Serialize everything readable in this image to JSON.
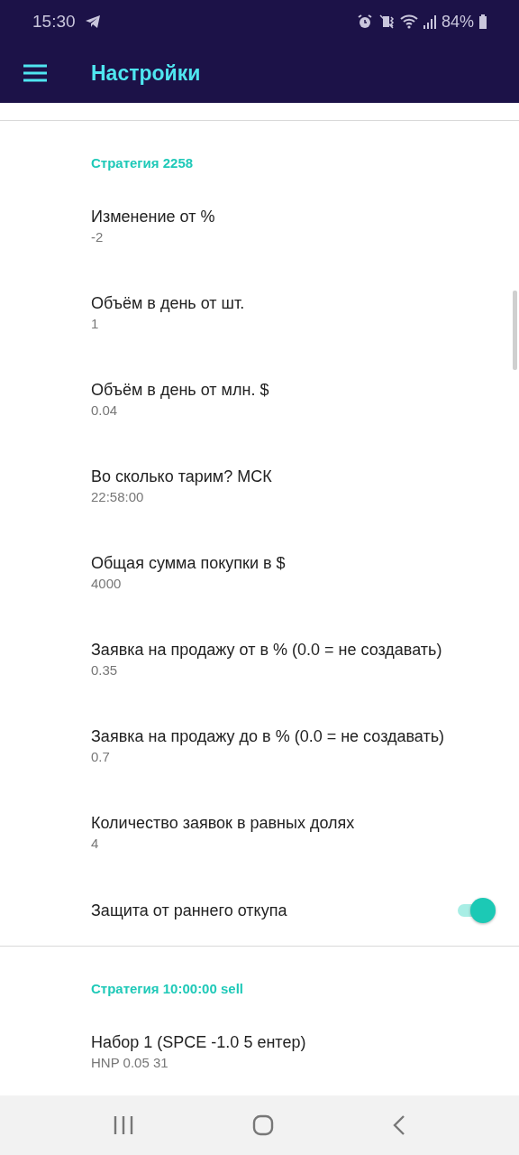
{
  "status_bar": {
    "time": "15:30",
    "battery": "84%"
  },
  "app_bar": {
    "title": "Настройки"
  },
  "sections": [
    {
      "title": "Стратегия 2258",
      "items": [
        {
          "kind": "text",
          "title": "Изменение от %",
          "value": "-2"
        },
        {
          "kind": "text",
          "title": "Объём в день от шт.",
          "value": "1"
        },
        {
          "kind": "text",
          "title": "Объём в день от млн. $",
          "value": "0.04"
        },
        {
          "kind": "text",
          "title": "Во сколько тарим? МСК",
          "value": "22:58:00"
        },
        {
          "kind": "text",
          "title": "Общая сумма покупки в $",
          "value": "4000"
        },
        {
          "kind": "text",
          "title": "Заявка на продажу от в % (0.0 = не создавать)",
          "value": "0.35"
        },
        {
          "kind": "text",
          "title": "Заявка на продажу до в % (0.0 = не создавать)",
          "value": "0.7"
        },
        {
          "kind": "text",
          "title": "Количество заявок в равных долях",
          "value": "4"
        },
        {
          "kind": "switch",
          "title": "Защита от раннего откупа",
          "on": true
        }
      ]
    },
    {
      "title": "Стратегия 10:00:00 sell",
      "items": [
        {
          "kind": "text",
          "title": "Набор 1 (SPCE -1.0 5 ентер)",
          "value": "HNP 0.05 31"
        }
      ]
    }
  ]
}
